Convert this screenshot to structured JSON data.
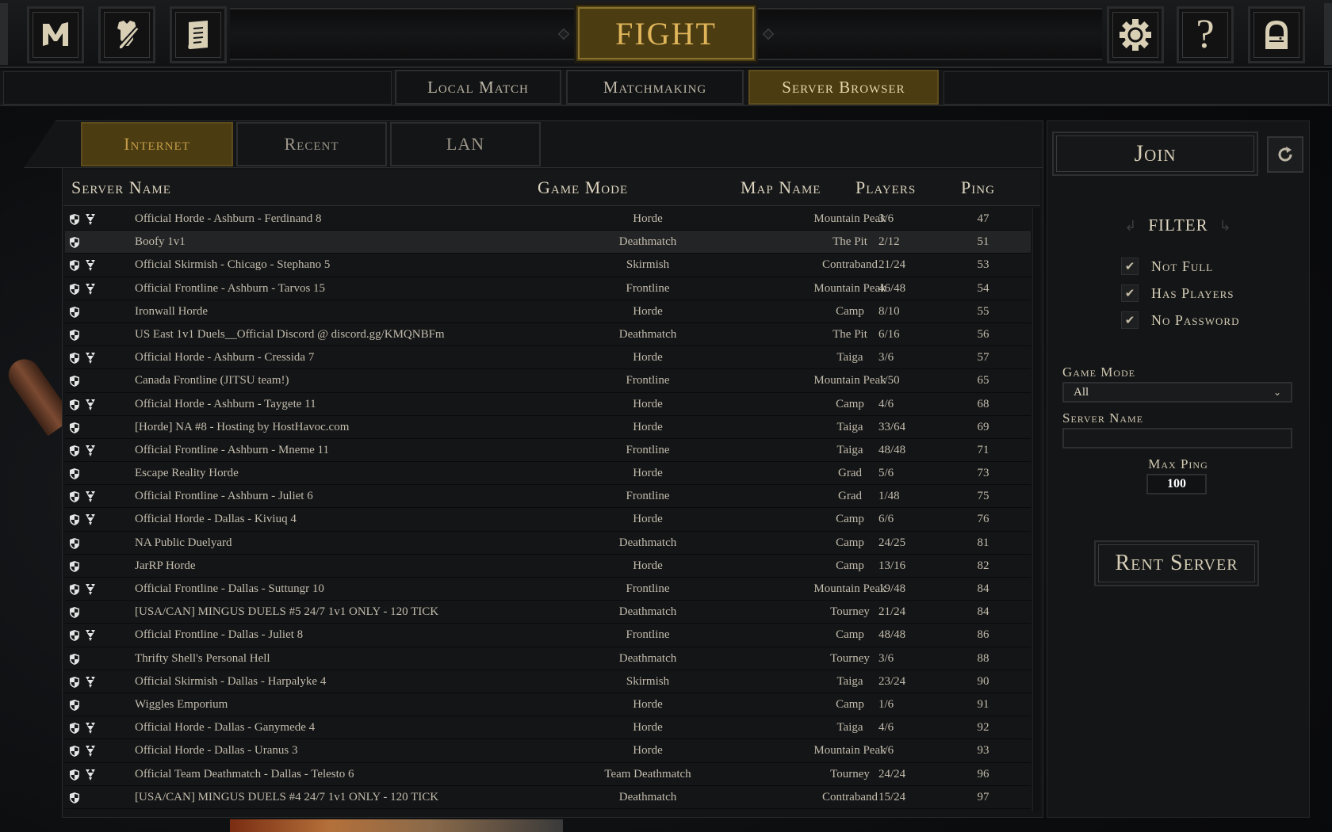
{
  "topbar": {
    "left_icons": [
      {
        "name": "mordhau-logo-icon",
        "label": "M"
      },
      {
        "name": "armory-icon",
        "label": "Armory"
      },
      {
        "name": "scroll-icon",
        "label": "Scroll"
      }
    ],
    "fight_label": "FIGHT",
    "right_icons": [
      {
        "name": "gear-icon",
        "label": "Settings"
      },
      {
        "name": "help-icon",
        "label": "?"
      },
      {
        "name": "exit-door-icon",
        "label": "Exit"
      }
    ]
  },
  "mode_tabs": [
    {
      "label": "Local Match",
      "active": false
    },
    {
      "label": "Matchmaking",
      "active": false
    },
    {
      "label": "Server Browser",
      "active": true
    }
  ],
  "source_tabs": [
    {
      "label": "Internet",
      "active": true
    },
    {
      "label": "Recent",
      "active": false
    },
    {
      "label": "LAN",
      "active": false
    }
  ],
  "columns": {
    "name": "Server Name",
    "mode": "Game Mode",
    "map": "Map Name",
    "players": "Players",
    "ping": "Ping"
  },
  "servers": [
    {
      "official": true,
      "name": "Official Horde - Ashburn - Ferdinand 8",
      "mode": "Horde",
      "map": "Mountain Peak",
      "players": "3/6",
      "ping": "47"
    },
    {
      "official": false,
      "name": "Boofy 1v1",
      "mode": "Deathmatch",
      "map": "The Pit",
      "players": "2/12",
      "ping": "51",
      "selected": true
    },
    {
      "official": true,
      "name": "Official Skirmish - Chicago - Stephano 5",
      "mode": "Skirmish",
      "map": "Contraband",
      "players": "21/24",
      "ping": "53"
    },
    {
      "official": true,
      "name": "Official Frontline - Ashburn - Tarvos 15",
      "mode": "Frontline",
      "map": "Mountain Peak",
      "players": "46/48",
      "ping": "54"
    },
    {
      "official": false,
      "name": "Ironwall Horde",
      "mode": "Horde",
      "map": "Camp",
      "players": "8/10",
      "ping": "55"
    },
    {
      "official": false,
      "name": "US East 1v1 Duels__Official Discord @ discord.gg/KMQNBFm",
      "mode": "Deathmatch",
      "map": "The Pit",
      "players": "6/16",
      "ping": "56"
    },
    {
      "official": true,
      "name": "Official Horde - Ashburn - Cressida 7",
      "mode": "Horde",
      "map": "Taiga",
      "players": "3/6",
      "ping": "57"
    },
    {
      "official": false,
      "name": "Canada Frontline (JITSU team!)",
      "mode": "Frontline",
      "map": "Mountain Peak",
      "players": "1/50",
      "ping": "65"
    },
    {
      "official": true,
      "name": "Official Horde - Ashburn - Taygete 11",
      "mode": "Horde",
      "map": "Camp",
      "players": "4/6",
      "ping": "68"
    },
    {
      "official": false,
      "name": "[Horde] NA #8 - Hosting by HostHavoc.com",
      "mode": "Horde",
      "map": "Taiga",
      "players": "33/64",
      "ping": "69"
    },
    {
      "official": true,
      "name": "Official Frontline - Ashburn - Mneme 11",
      "mode": "Frontline",
      "map": "Taiga",
      "players": "48/48",
      "ping": "71"
    },
    {
      "official": false,
      "name": "Escape Reality Horde",
      "mode": "Horde",
      "map": "Grad",
      "players": "5/6",
      "ping": "73"
    },
    {
      "official": true,
      "name": "Official Frontline - Ashburn - Juliet 6",
      "mode": "Frontline",
      "map": "Grad",
      "players": "1/48",
      "ping": "75"
    },
    {
      "official": true,
      "name": "Official Horde - Dallas - Kiviuq 4",
      "mode": "Horde",
      "map": "Camp",
      "players": "6/6",
      "ping": "76"
    },
    {
      "official": false,
      "name": "NA Public Duelyard",
      "mode": "Deathmatch",
      "map": "Camp",
      "players": "24/25",
      "ping": "81"
    },
    {
      "official": false,
      "name": "JarRP Horde",
      "mode": "Horde",
      "map": "Camp",
      "players": "13/16",
      "ping": "82"
    },
    {
      "official": true,
      "name": "Official Frontline - Dallas - Suttungr 10",
      "mode": "Frontline",
      "map": "Mountain Peak",
      "players": "19/48",
      "ping": "84"
    },
    {
      "official": false,
      "name": "[USA/CAN] MINGUS DUELS #5 24/7 1v1 ONLY - 120 TICK",
      "mode": "Deathmatch",
      "map": "Tourney",
      "players": "21/24",
      "ping": "84"
    },
    {
      "official": true,
      "name": "Official Frontline - Dallas - Juliet 8",
      "mode": "Frontline",
      "map": "Camp",
      "players": "48/48",
      "ping": "86"
    },
    {
      "official": false,
      "name": "Thrifty Shell's Personal Hell",
      "mode": "Deathmatch",
      "map": "Tourney",
      "players": "3/6",
      "ping": "88"
    },
    {
      "official": true,
      "name": "Official Skirmish - Dallas - Harpalyke 4",
      "mode": "Skirmish",
      "map": "Taiga",
      "players": "23/24",
      "ping": "90"
    },
    {
      "official": false,
      "name": "Wiggles Emporium",
      "mode": "Horde",
      "map": "Camp",
      "players": "1/6",
      "ping": "91"
    },
    {
      "official": true,
      "name": "Official Horde - Dallas - Ganymede 4",
      "mode": "Horde",
      "map": "Taiga",
      "players": "4/6",
      "ping": "92"
    },
    {
      "official": true,
      "name": "Official Horde - Dallas - Uranus 3",
      "mode": "Horde",
      "map": "Mountain Peak",
      "players": "1/6",
      "ping": "93"
    },
    {
      "official": true,
      "name": "Official Team Deathmatch - Dallas - Telesto 6",
      "mode": "Team Deathmatch",
      "map": "Tourney",
      "players": "24/24",
      "ping": "96"
    },
    {
      "official": false,
      "name": "[USA/CAN] MINGUS DUELS #4 24/7 1v1 ONLY - 120 TICK",
      "mode": "Deathmatch",
      "map": "Contraband",
      "players": "15/24",
      "ping": "97"
    }
  ],
  "right_panel": {
    "join_label": "Join",
    "refresh_icon": "refresh-icon",
    "filter_title": "FILTER",
    "filters": [
      {
        "label": "Not Full",
        "checked": true
      },
      {
        "label": "Has Players",
        "checked": true
      },
      {
        "label": "No Password",
        "checked": true
      }
    ],
    "game_mode_label": "Game Mode",
    "game_mode_value": "All",
    "server_name_label": "Server Name",
    "server_name_value": "",
    "max_ping_label": "Max Ping",
    "max_ping_value": "100",
    "rent_label": "Rent Server"
  }
}
